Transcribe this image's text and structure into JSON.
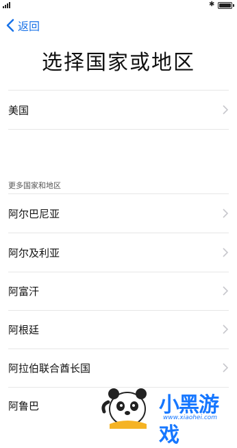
{
  "nav": {
    "back_label": "返回"
  },
  "title": "选择国家或地区",
  "current_region": {
    "label": "美国"
  },
  "section_header": "更多国家和地区",
  "countries": [
    {
      "label": "阿尔巴尼亚"
    },
    {
      "label": "阿尔及利亚"
    },
    {
      "label": "阿富汗"
    },
    {
      "label": "阿根廷"
    },
    {
      "label": "阿拉伯联合酋长国"
    },
    {
      "label": "阿鲁巴"
    }
  ],
  "watermark": {
    "title": "小黑游戏",
    "site": "www.xiaohei.com"
  },
  "colors": {
    "accent": "#1a73e8",
    "divider": "#e6e6e6",
    "watermark": "#1677ff"
  },
  "icons": {
    "back": "chevron-left-icon",
    "row": "chevron-right-icon",
    "status": [
      "signal-icon",
      "bluetooth-icon",
      "battery-icon"
    ]
  }
}
